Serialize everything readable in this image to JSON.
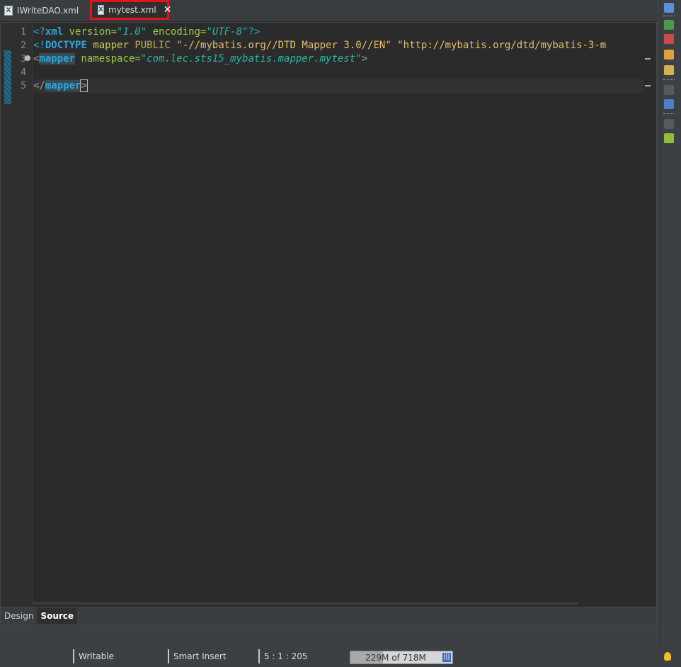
{
  "tabs": [
    {
      "label": "IWriteDAO.xml",
      "active": false
    },
    {
      "label": "mytest.xml",
      "active": true,
      "close": "✕"
    }
  ],
  "file_icon_letter": "X",
  "editor": {
    "line_numbers": [
      "1",
      "2",
      "3",
      "4",
      "5"
    ],
    "line1": {
      "open": "<?",
      "tag": "xml",
      "attr1": " version=",
      "val1": "\"1.0\"",
      "attr2": " encoding=",
      "val2": "\"UTF-8\"",
      "close": "?>"
    },
    "line2": {
      "open": "<!",
      "keyword": "DOCTYPE",
      "name": " mapper",
      "public": " PUBLIC",
      "pubid": " \"-//mybatis.org//DTD Mapper 3.0//EN\"",
      "sysid": " \"http://mybatis.org/dtd/mybatis-3-m"
    },
    "line3": {
      "open": "<",
      "tag": "mapper",
      "attr": " namespace=",
      "val": "\"com.lec.sts15_mybatis.mapper.mytest\"",
      "close": ">"
    },
    "line5": {
      "open": "</",
      "tag": "mapper",
      "close": ">"
    }
  },
  "bottom_tabs": [
    {
      "label": "Design",
      "active": false
    },
    {
      "label": "Source",
      "active": true
    }
  ],
  "status": {
    "writable": "Writable",
    "insert_mode": "Smart Insert",
    "position": "5 : 1 : 205",
    "heap": "229M of 718M",
    "heap_fraction": 0.32
  },
  "colors": {
    "tag": "#2aa6d8",
    "attribute": "#9ccc3a",
    "value": "#27b6a0",
    "string": "#e3c06b",
    "active_tab_highlight": "#e0141a"
  }
}
